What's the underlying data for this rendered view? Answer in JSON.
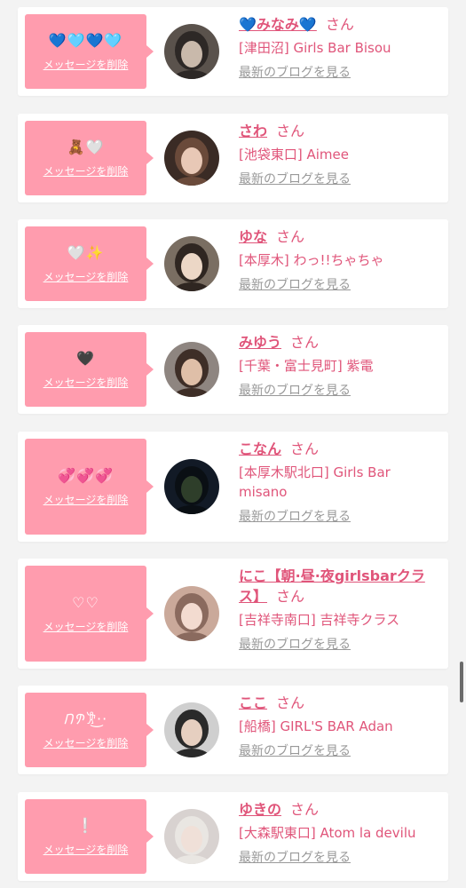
{
  "colors": {
    "background": "#f3f3f3",
    "card": "#ffffff",
    "bubble": "#ff9cae",
    "accent_text": "#e0557a",
    "muted_link": "#999999"
  },
  "labels": {
    "delete": "メッセージを削除",
    "blog": "最新のブログを見る",
    "honorific": "さん"
  },
  "items": [
    {
      "name": "💙みなみ💙",
      "shop": "[津田沼] Girls Bar Bisou",
      "message": "💙🩵💙🩵",
      "avatar": {
        "bg": "#5a524c",
        "face": "#c9b9ab",
        "hair": "#2d2826",
        "icon": "person-with-heart-sticker"
      }
    },
    {
      "name": "さわ",
      "shop": "[池袋東口] Aimee",
      "message": "🧸🤍",
      "avatar": {
        "bg": "#3a2b25",
        "face": "#e8c8b6",
        "hair": "#6a4a3a",
        "icon": "person"
      }
    },
    {
      "name": "ゆな",
      "shop": "[本厚木] わっ!!ちゃちゃ",
      "message": "🤍✨",
      "avatar": {
        "bg": "#7a6e62",
        "face": "#ecd7c6",
        "hair": "#2f2621",
        "icon": "person"
      }
    },
    {
      "name": "みゆう",
      "shop": "[千葉・富士見町] 紫電",
      "message": "🖤",
      "avatar": {
        "bg": "#8e8580",
        "face": "#dfbfa8",
        "hair": "#3e2e27",
        "icon": "person"
      }
    },
    {
      "name": "こなん",
      "shop": "[本厚木駅北口] Girls Bar misano",
      "message": "💞💞💞",
      "avatar": {
        "bg": "#121a26",
        "face": "#2e3e2a",
        "hair": "#0a0f14",
        "icon": "night-scenery"
      }
    },
    {
      "name": "にこ【朝·昼·夜girlsbarクラス】",
      "shop": "[吉祥寺南口] 吉祥寺クラス",
      "message": "♡♡",
      "avatar": {
        "bg": "#caa99a",
        "face": "#f3dbd0",
        "hair": "#8a6a5e",
        "icon": "person-with-cat-filter"
      }
    },
    {
      "name": "ここ",
      "shop": "[船橋] GIRL'S BAR Adan",
      "message": "𐦂𐨮𐨭·͜·",
      "avatar": {
        "bg": "#cfcfcf",
        "face": "#e6cfc0",
        "hair": "#2a2a2a",
        "icon": "person-with-phone"
      }
    },
    {
      "name": "ゆきの",
      "shop": "[大森駅東口] Atom la devilu",
      "message": "❕",
      "avatar": {
        "bg": "#d8d2d0",
        "face": "#f0e0d8",
        "hair": "#e9e6e2",
        "icon": "person-with-glasses"
      }
    }
  ]
}
